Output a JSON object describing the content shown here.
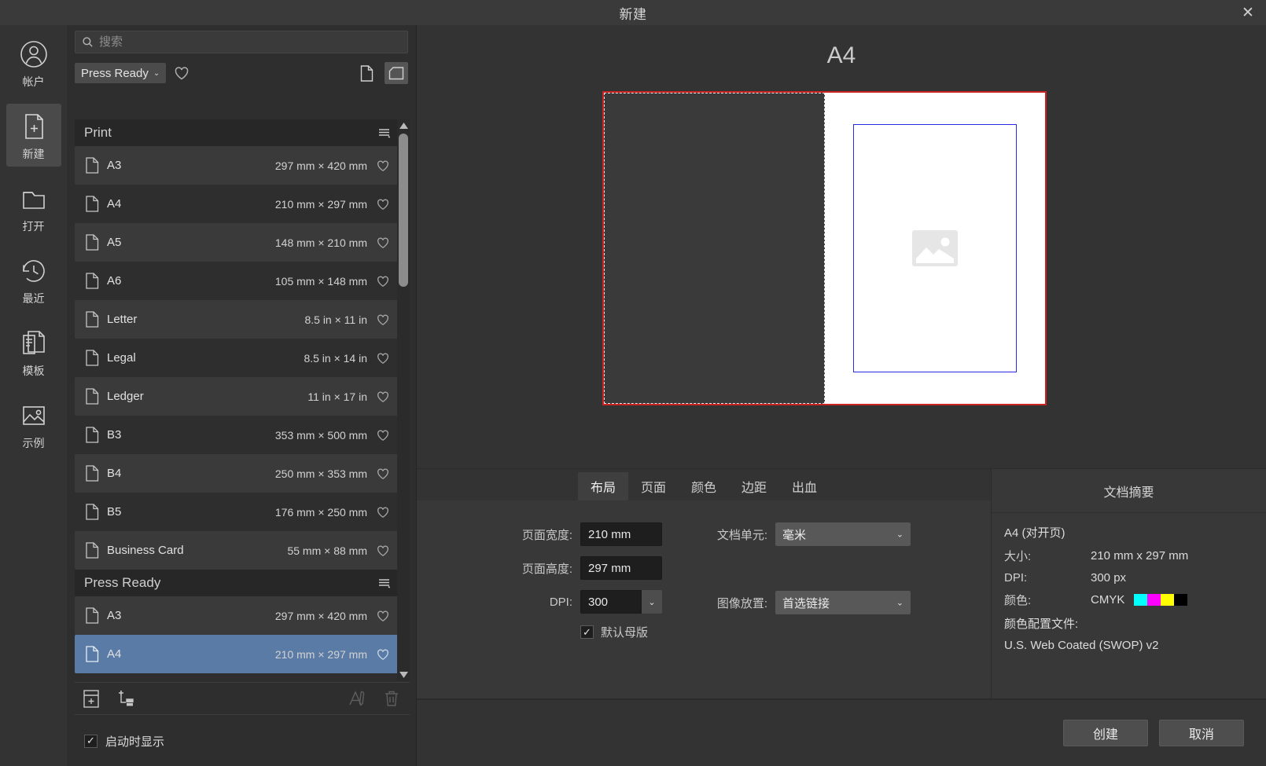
{
  "window": {
    "title": "新建",
    "close_label": "✕"
  },
  "rail": {
    "items": [
      {
        "label": "帐户",
        "icon": "account-icon",
        "active": false
      },
      {
        "label": "新建",
        "icon": "new-document-icon",
        "active": true
      },
      {
        "label": "打开",
        "icon": "open-folder-icon",
        "active": false
      },
      {
        "label": "最近",
        "icon": "recent-clock-icon",
        "active": false
      },
      {
        "label": "模板",
        "icon": "templates-icon",
        "active": false
      },
      {
        "label": "示例",
        "icon": "samples-image-icon",
        "active": false
      }
    ]
  },
  "search": {
    "placeholder": "搜索",
    "value": ""
  },
  "filter": {
    "category": "Press Ready",
    "favorite_icon": "heart-icon",
    "view_list_icon": "document-view-icon",
    "view_thumb_icon": "thumbnail-view-icon"
  },
  "presets": {
    "groups": [
      {
        "title": "Print",
        "items": [
          {
            "name": "A3",
            "dimensions": "297 mm × 420 mm"
          },
          {
            "name": "A4",
            "dimensions": "210 mm × 297 mm"
          },
          {
            "name": "A5",
            "dimensions": "148 mm × 210 mm"
          },
          {
            "name": "A6",
            "dimensions": "105 mm × 148 mm"
          },
          {
            "name": "Letter",
            "dimensions": "8.5 in × 11 in"
          },
          {
            "name": "Legal",
            "dimensions": "8.5 in × 14 in"
          },
          {
            "name": "Ledger",
            "dimensions": "11 in × 17 in"
          },
          {
            "name": "B3",
            "dimensions": "353 mm × 500 mm"
          },
          {
            "name": "B4",
            "dimensions": "250 mm × 353 mm"
          },
          {
            "name": "B5",
            "dimensions": "176 mm × 250 mm"
          },
          {
            "name": "Business Card",
            "dimensions": "55 mm × 88 mm"
          }
        ]
      },
      {
        "title": "Press Ready",
        "items": [
          {
            "name": "A3",
            "dimensions": "297 mm × 420 mm"
          },
          {
            "name": "A4",
            "dimensions": "210 mm × 297 mm",
            "selected": true
          }
        ]
      }
    ]
  },
  "list_tools": {
    "add_preset_icon": "add-preset-icon",
    "add_category_icon": "add-category-icon",
    "rename_icon": "rename-icon",
    "delete_icon": "trash-icon"
  },
  "startup": {
    "label": "启动时显示",
    "checked": true,
    "check_glyph": "✓"
  },
  "preview": {
    "title": "A4",
    "placeholder_icon": "image-placeholder-icon",
    "bleed_color": "#cc2222",
    "page_color": "#ffffff",
    "margin_color": "#2a2ae0",
    "spread_dash_color": "#e8e8e8"
  },
  "options": {
    "tabs": [
      {
        "label": "布局",
        "active": true
      },
      {
        "label": "页面",
        "active": false
      },
      {
        "label": "颜色",
        "active": false
      },
      {
        "label": "边距",
        "active": false
      },
      {
        "label": "出血",
        "active": false
      }
    ],
    "page_width": {
      "label": "页面宽度:",
      "value": "210 mm"
    },
    "page_height": {
      "label": "页面高度:",
      "value": "297 mm"
    },
    "dpi": {
      "label": "DPI:",
      "value": "300"
    },
    "default_master": {
      "label": "默认母版",
      "checked": true,
      "check_glyph": "✓"
    },
    "doc_units": {
      "label": "文档单元:",
      "value": "毫米"
    },
    "image_placement": {
      "label": "图像放置:",
      "value": "首选链接"
    },
    "chevron": "⌄"
  },
  "summary": {
    "title": "文档摘要",
    "name": "A4 (对开页)",
    "size": {
      "label": "大小:",
      "value": "210 mm  x  297 mm"
    },
    "dpi": {
      "label": "DPI:",
      "value": "300 px"
    },
    "color": {
      "label": "颜色:",
      "value": "CMYK",
      "swatches": [
        "#00ffff",
        "#ff00ff",
        "#ffff00",
        "#000000"
      ]
    },
    "profile_label": "颜色配置文件:",
    "profile_value": "U.S. Web Coated (SWOP) v2"
  },
  "footer": {
    "create": "创建",
    "cancel": "取消"
  }
}
